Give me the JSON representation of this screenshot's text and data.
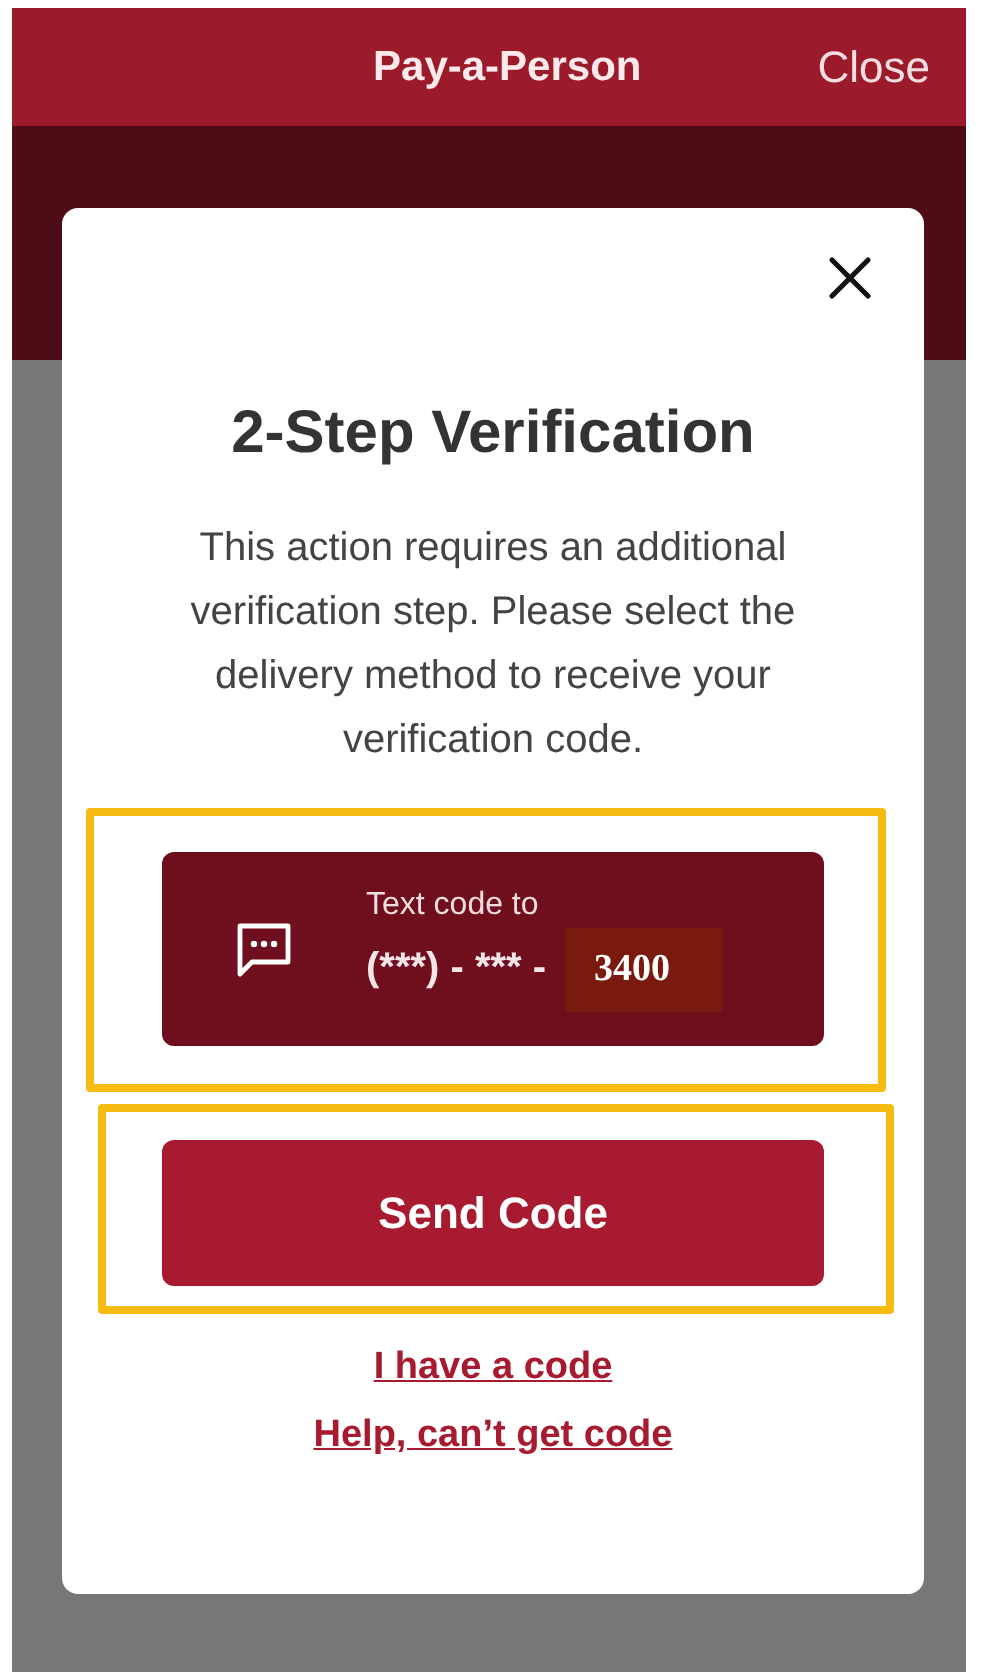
{
  "header": {
    "title": "Pay-a-Person",
    "close_label": "Close"
  },
  "dialog": {
    "title": "2-Step Verification",
    "message": "This action requires an additional verification step. Please select the delivery method to receive your verification code.",
    "delivery_option": {
      "label": "Text code to",
      "masked_number": "(***) - *** -",
      "last_digits": "3400"
    },
    "send_button": "Send Code",
    "links": [
      "I have a code",
      "Help, can’t get code"
    ]
  }
}
